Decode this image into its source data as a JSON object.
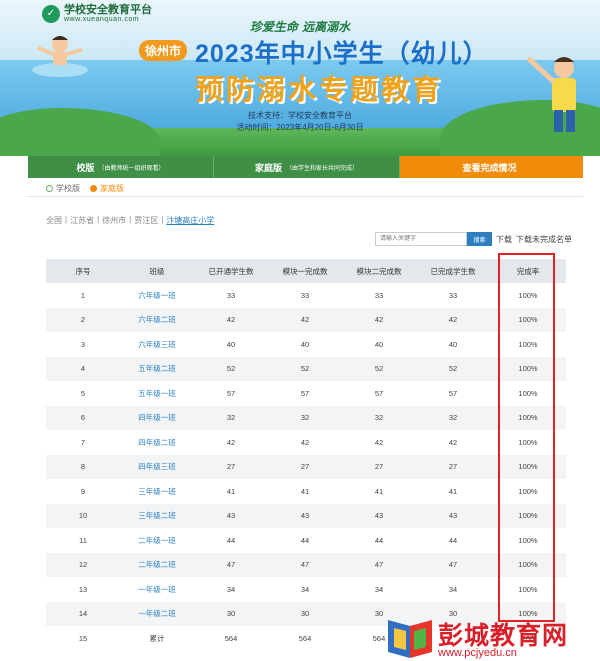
{
  "banner": {
    "logo_text": "学校安全教育平台",
    "logo_sub": "www.xueanquan.com",
    "slogan": "珍爱生命  远离溺水",
    "city": "徐州市",
    "title_line1": "2023年中小学生（幼儿）",
    "title_line2": "预防溺水专题教育",
    "support": "技术支持：学校安全教育平台",
    "period": "活动时间：2023年4月20日-6月30日"
  },
  "tabs": [
    {
      "label": "校版",
      "note": "（由教师统一组织观看）"
    },
    {
      "label": "家庭版",
      "note": "（由学生和家长共同完成）"
    },
    {
      "label": "查看完成情况",
      "note": ""
    }
  ],
  "radios": [
    {
      "label": "学校版",
      "checked": false
    },
    {
      "label": "家庭版",
      "checked": true
    }
  ],
  "breadcrumb": [
    "全国",
    "江苏省",
    "徐州市",
    "贾汪区",
    "汴塘高庄小学"
  ],
  "search": {
    "placeholder": "请输入关键字",
    "button": "搜索",
    "download": "下载",
    "download_unfinished": "下载未完成名单"
  },
  "table": {
    "headers": [
      "序号",
      "班级",
      "已开通学生数",
      "模块一完成数",
      "模块二完成数",
      "已完成学生数",
      "完成率"
    ],
    "rows": [
      [
        "1",
        "六年级一班",
        "33",
        "33",
        "33",
        "33",
        "100%"
      ],
      [
        "2",
        "六年级二班",
        "42",
        "42",
        "42",
        "42",
        "100%"
      ],
      [
        "3",
        "六年级三班",
        "40",
        "40",
        "40",
        "40",
        "100%"
      ],
      [
        "4",
        "五年级二班",
        "52",
        "52",
        "52",
        "52",
        "100%"
      ],
      [
        "5",
        "五年级一班",
        "57",
        "57",
        "57",
        "57",
        "100%"
      ],
      [
        "6",
        "四年级一班",
        "32",
        "32",
        "32",
        "32",
        "100%"
      ],
      [
        "7",
        "四年级二班",
        "42",
        "42",
        "42",
        "42",
        "100%"
      ],
      [
        "8",
        "四年级三班",
        "27",
        "27",
        "27",
        "27",
        "100%"
      ],
      [
        "9",
        "三年级一班",
        "41",
        "41",
        "41",
        "41",
        "100%"
      ],
      [
        "10",
        "三年级二班",
        "43",
        "43",
        "43",
        "43",
        "100%"
      ],
      [
        "11",
        "二年级一班",
        "44",
        "44",
        "44",
        "44",
        "100%"
      ],
      [
        "12",
        "二年级二班",
        "47",
        "47",
        "47",
        "47",
        "100%"
      ],
      [
        "13",
        "一年级一班",
        "34",
        "34",
        "34",
        "34",
        "100%"
      ],
      [
        "14",
        "一年级二班",
        "30",
        "30",
        "30",
        "30",
        "100%"
      ],
      [
        "15",
        "累计",
        "564",
        "564",
        "564",
        "",
        "100"
      ]
    ]
  },
  "watermark": {
    "title": "彭城教育网",
    "url": "www.pcjyedu.cn"
  },
  "colors": {
    "tab_green": "#3f8f46",
    "tab_active": "#f08c0a",
    "link_blue": "#2a7fc2",
    "highlight_red": "#e02424"
  }
}
